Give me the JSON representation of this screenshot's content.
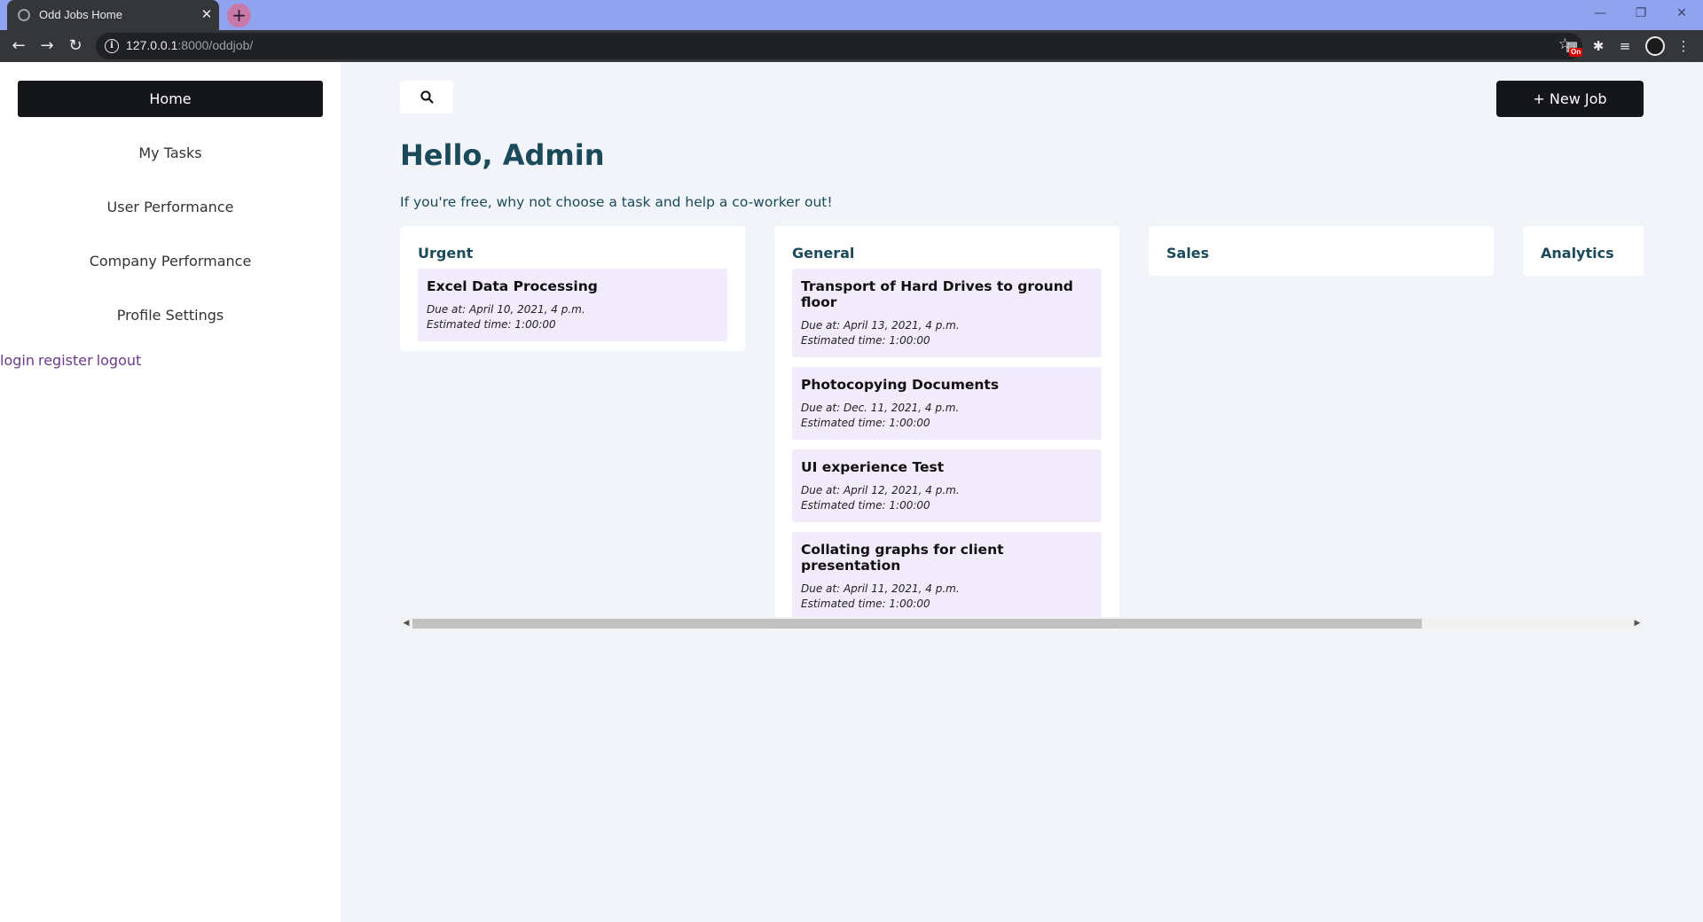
{
  "browser": {
    "tab_title": "Odd Jobs Home",
    "tab_close": "✕",
    "new_tab": "+",
    "url_host": "127.0.0.1",
    "url_rest": ":8000/oddjob/",
    "ext_badge": "On",
    "icons": [
      "back-arrow-icon",
      "forward-arrow-icon",
      "reload-icon",
      "info-icon",
      "star-icon",
      "puzzle-icon",
      "media-icon",
      "menu-icon"
    ]
  },
  "sidebar": {
    "home": "Home",
    "items": [
      {
        "label": "My Tasks"
      },
      {
        "label": "User Performance"
      },
      {
        "label": "Company Performance"
      },
      {
        "label": "Profile Settings"
      }
    ],
    "auth": {
      "login": "login",
      "register": "register",
      "logout": "logout"
    }
  },
  "header": {
    "new_job": "+ New Job",
    "greeting": "Hello, Admin",
    "subtitle": "If you're free, why not choose a task and help a co-worker out!"
  },
  "columns": [
    {
      "title": "Urgent",
      "tasks": [
        {
          "title": "Excel Data Processing",
          "due": "Due at: April 10, 2021, 4 p.m.",
          "estimate": "Estimated time: 1:00:00"
        }
      ]
    },
    {
      "title": "General",
      "tasks": [
        {
          "title": "Transport of Hard Drives to ground floor",
          "due": "Due at: April 13, 2021, 4 p.m.",
          "estimate": "Estimated time: 1:00:00"
        },
        {
          "title": "Photocopying Documents",
          "due": "Due at: Dec. 11, 2021, 4 p.m.",
          "estimate": "Estimated time: 1:00:00"
        },
        {
          "title": "UI experience Test",
          "due": "Due at: April 12, 2021, 4 p.m.",
          "estimate": "Estimated time: 1:00:00"
        },
        {
          "title": "Collating graphs for client presentation",
          "due": "Due at: April 11, 2021, 4 p.m.",
          "estimate": "Estimated time: 1:00:00"
        }
      ]
    },
    {
      "title": "Sales",
      "tasks": []
    },
    {
      "title": "Analytics",
      "tasks": []
    }
  ],
  "colors": {
    "sidebar_active": "#15161a",
    "heading": "#1b4a5a",
    "task_bg": "#f1ebfb",
    "tab_strip": "#8fa3ee"
  }
}
